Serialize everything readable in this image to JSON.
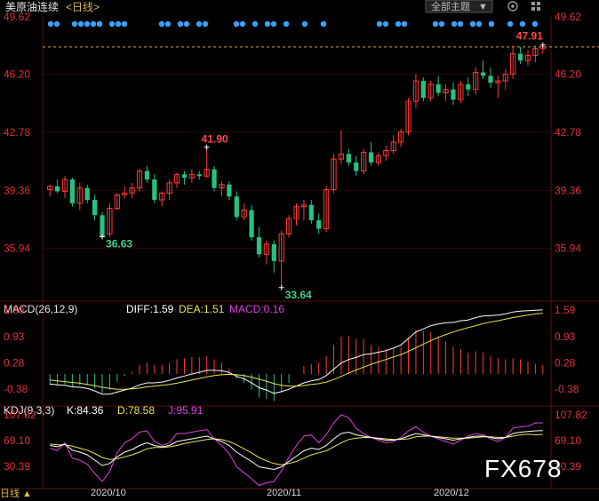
{
  "header": {
    "title": "美原油连续",
    "period": "<日线>",
    "theme_button": "全部主题",
    "theme_arrow": "▼"
  },
  "colors": {
    "up": "#ff3b3b",
    "down": "#26c281",
    "dif": "#ffffff",
    "dea": "#e6e64a",
    "macd": "#e040e0",
    "k": "#ffffff",
    "d": "#e6e64a",
    "j": "#e040e0",
    "axis": "#e0303a",
    "grid": "#7a1a1a",
    "dot": "#3aa0ff",
    "last_price_line": "#e0a030"
  },
  "price_axis": {
    "ticks": [
      "49.62",
      "46.20",
      "42.78",
      "39.36",
      "35.94"
    ],
    "ylim": [
      33.0,
      49.62
    ]
  },
  "annotations": {
    "high_left": "41.90",
    "low_left": "36.63",
    "low": "33.64",
    "high": "47.91"
  },
  "macd_panel": {
    "label": "MACD(26,12,9)",
    "dif_label": "DIFF:1.59",
    "dea_label": "DEA:1.51",
    "macd_label": "MACD:0.16",
    "ticks": [
      "1.59",
      "0.93",
      "0.28",
      "-0.38"
    ]
  },
  "kdj_panel": {
    "label": "KDJ(9,3,3)",
    "k_label": "K:84.36",
    "d_label": "D:78.58",
    "j_label": "J:95.91",
    "ticks": [
      "107.82",
      "69.10",
      "30.39"
    ]
  },
  "dates": [
    "2020/10",
    "2020/11",
    "2020/12"
  ],
  "bottom_left": "日线 ▲",
  "watermark": "FX678",
  "chart_data": {
    "type": "candlestick",
    "candles": [
      [
        39.4,
        39.7,
        39.0,
        39.6
      ],
      [
        39.6,
        40.0,
        39.2,
        39.3
      ],
      [
        39.3,
        40.2,
        38.9,
        40.0
      ],
      [
        40.0,
        40.1,
        38.4,
        38.6
      ],
      [
        38.6,
        39.8,
        38.2,
        39.5
      ],
      [
        39.5,
        39.7,
        38.6,
        38.8
      ],
      [
        38.8,
        39.1,
        37.6,
        37.9
      ],
      [
        37.9,
        38.1,
        36.5,
        36.6
      ],
      [
        36.8,
        38.6,
        36.6,
        38.3
      ],
      [
        38.3,
        39.2,
        38.2,
        39.1
      ],
      [
        39.1,
        39.6,
        38.9,
        39.2
      ],
      [
        39.2,
        39.8,
        38.9,
        39.5
      ],
      [
        39.5,
        40.6,
        39.3,
        40.5
      ],
      [
        40.5,
        40.8,
        39.8,
        40.0
      ],
      [
        40.0,
        40.3,
        38.6,
        38.8
      ],
      [
        38.8,
        39.3,
        38.4,
        39.2
      ],
      [
        39.2,
        40.0,
        38.8,
        39.8
      ],
      [
        39.8,
        40.4,
        39.5,
        40.3
      ],
      [
        40.3,
        40.5,
        39.7,
        40.1
      ],
      [
        40.1,
        40.6,
        39.8,
        40.3
      ],
      [
        40.3,
        40.5,
        40.0,
        40.2
      ],
      [
        40.2,
        41.9,
        40.1,
        40.6
      ],
      [
        40.6,
        40.8,
        39.3,
        39.5
      ],
      [
        39.5,
        39.9,
        39.0,
        39.7
      ],
      [
        39.7,
        39.9,
        38.8,
        39.0
      ],
      [
        39.0,
        39.3,
        37.6,
        37.8
      ],
      [
        37.8,
        38.6,
        37.6,
        38.2
      ],
      [
        38.2,
        38.5,
        36.4,
        36.6
      ],
      [
        36.6,
        37.2,
        35.4,
        35.6
      ],
      [
        35.6,
        36.4,
        35.0,
        36.2
      ],
      [
        36.2,
        36.4,
        34.5,
        35.2
      ],
      [
        35.2,
        37.0,
        33.64,
        36.8
      ],
      [
        36.8,
        37.9,
        36.6,
        37.7
      ],
      [
        37.7,
        38.6,
        37.3,
        38.4
      ],
      [
        38.4,
        38.8,
        37.6,
        38.5
      ],
      [
        38.5,
        38.8,
        37.4,
        37.6
      ],
      [
        37.6,
        38.0,
        36.8,
        37.1
      ],
      [
        37.1,
        39.6,
        36.9,
        39.4
      ],
      [
        39.4,
        41.5,
        39.2,
        41.2
      ],
      [
        41.2,
        42.9,
        40.9,
        41.5
      ],
      [
        41.5,
        41.8,
        40.8,
        41.0
      ],
      [
        41.0,
        41.4,
        40.2,
        40.5
      ],
      [
        40.5,
        41.8,
        40.3,
        41.6
      ],
      [
        41.6,
        42.2,
        40.8,
        41.0
      ],
      [
        41.0,
        41.6,
        40.8,
        41.4
      ],
      [
        41.4,
        42.0,
        41.1,
        41.7
      ],
      [
        41.7,
        42.6,
        41.5,
        42.2
      ],
      [
        42.2,
        43.0,
        41.9,
        42.8
      ],
      [
        42.8,
        44.8,
        42.6,
        44.6
      ],
      [
        44.6,
        46.2,
        44.2,
        45.8
      ],
      [
        45.8,
        46.0,
        44.6,
        44.8
      ],
      [
        44.8,
        45.8,
        44.6,
        45.6
      ],
      [
        45.6,
        46.1,
        44.9,
        45.1
      ],
      [
        45.1,
        45.6,
        44.6,
        45.3
      ],
      [
        45.3,
        45.7,
        44.4,
        44.7
      ],
      [
        44.7,
        45.8,
        44.5,
        45.6
      ],
      [
        45.6,
        46.0,
        44.9,
        45.3
      ],
      [
        45.3,
        46.6,
        45.0,
        46.3
      ],
      [
        46.3,
        47.0,
        45.9,
        46.1
      ],
      [
        46.1,
        46.6,
        45.4,
        45.7
      ],
      [
        45.7,
        46.1,
        44.8,
        45.8
      ],
      [
        45.8,
        46.5,
        45.3,
        46.2
      ],
      [
        46.2,
        47.9,
        45.9,
        47.4
      ],
      [
        47.4,
        47.8,
        46.8,
        47.0
      ],
      [
        47.0,
        47.6,
        46.7,
        47.3
      ],
      [
        47.3,
        47.9,
        46.9,
        47.7
      ],
      [
        47.7,
        47.91,
        47.4,
        47.8
      ]
    ],
    "macd": {
      "dif": [
        -0.25,
        -0.27,
        -0.28,
        -0.32,
        -0.33,
        -0.36,
        -0.42,
        -0.5,
        -0.5,
        -0.45,
        -0.4,
        -0.35,
        -0.27,
        -0.22,
        -0.22,
        -0.2,
        -0.16,
        -0.1,
        -0.05,
        0.0,
        0.04,
        0.09,
        0.09,
        0.08,
        0.04,
        -0.06,
        -0.12,
        -0.22,
        -0.34,
        -0.4,
        -0.48,
        -0.44,
        -0.38,
        -0.3,
        -0.22,
        -0.17,
        -0.14,
        -0.04,
        0.12,
        0.27,
        0.36,
        0.41,
        0.48,
        0.5,
        0.54,
        0.58,
        0.64,
        0.72,
        0.88,
        1.04,
        1.12,
        1.2,
        1.24,
        1.27,
        1.28,
        1.32,
        1.34,
        1.4,
        1.44,
        1.45,
        1.46,
        1.49,
        1.54,
        1.56,
        1.57,
        1.58,
        1.59
      ],
      "dea": [
        -0.15,
        -0.17,
        -0.19,
        -0.21,
        -0.23,
        -0.26,
        -0.29,
        -0.33,
        -0.36,
        -0.38,
        -0.38,
        -0.37,
        -0.35,
        -0.32,
        -0.3,
        -0.28,
        -0.26,
        -0.23,
        -0.19,
        -0.15,
        -0.11,
        -0.07,
        -0.04,
        -0.02,
        -0.01,
        -0.02,
        -0.04,
        -0.08,
        -0.13,
        -0.18,
        -0.24,
        -0.28,
        -0.3,
        -0.3,
        -0.29,
        -0.26,
        -0.24,
        -0.2,
        -0.14,
        -0.06,
        0.02,
        0.1,
        0.17,
        0.24,
        0.3,
        0.36,
        0.42,
        0.48,
        0.56,
        0.65,
        0.74,
        0.83,
        0.91,
        0.98,
        1.04,
        1.1,
        1.15,
        1.2,
        1.25,
        1.29,
        1.32,
        1.36,
        1.4,
        1.43,
        1.46,
        1.49,
        1.51
      ]
    },
    "kdj": {
      "k": [
        62,
        60,
        64,
        55,
        52,
        48,
        40,
        32,
        35,
        45,
        52,
        56,
        62,
        66,
        62,
        60,
        62,
        68,
        70,
        72,
        74,
        76,
        72,
        68,
        62,
        52,
        45,
        38,
        30,
        28,
        26,
        30,
        38,
        46,
        54,
        58,
        56,
        62,
        72,
        80,
        82,
        78,
        76,
        74,
        72,
        70,
        70,
        72,
        76,
        80,
        78,
        76,
        74,
        72,
        70,
        72,
        74,
        76,
        76,
        74,
        72,
        74,
        80,
        82,
        83,
        84,
        84.36
      ],
      "d": [
        64,
        63,
        63,
        61,
        58,
        55,
        50,
        44,
        41,
        42,
        45,
        48,
        52,
        57,
        59,
        59,
        60,
        62,
        65,
        67,
        69,
        71,
        72,
        71,
        68,
        63,
        57,
        51,
        44,
        39,
        35,
        33,
        35,
        38,
        43,
        48,
        51,
        54,
        60,
        66,
        71,
        73,
        74,
        74,
        73,
        72,
        71,
        71,
        72,
        75,
        76,
        76,
        75,
        74,
        73,
        73,
        73,
        74,
        75,
        75,
        74,
        74,
        76,
        78,
        79,
        78,
        78.58
      ],
      "j": [
        58,
        54,
        66,
        43,
        40,
        34,
        20,
        8,
        23,
        51,
        66,
        72,
        82,
        84,
        68,
        62,
        66,
        80,
        80,
        82,
        84,
        86,
        72,
        62,
        50,
        30,
        21,
        12,
        2,
        6,
        8,
        24,
        44,
        62,
        76,
        78,
        66,
        78,
        96,
        108,
        104,
        88,
        80,
        74,
        70,
        66,
        68,
        74,
        84,
        90,
        82,
        76,
        72,
        68,
        64,
        70,
        76,
        80,
        78,
        72,
        68,
        74,
        88,
        90,
        91,
        96,
        95.91
      ]
    }
  }
}
